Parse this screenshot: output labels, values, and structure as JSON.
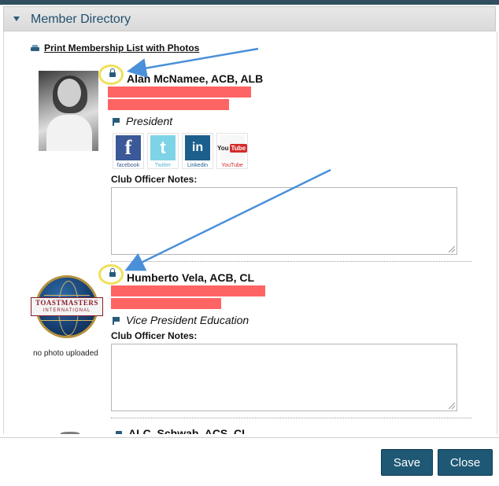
{
  "header": {
    "title": "Member Directory"
  },
  "print_link": {
    "label": "Print Membership List with Photos"
  },
  "members": [
    {
      "name": "Alan McNamee, ACB, ALB",
      "role": "President",
      "notes_label": "Club Officer Notes:",
      "notes_value": "",
      "social": [
        {
          "name": "facebook-icon",
          "glyph": "f",
          "caption": "facebook"
        },
        {
          "name": "twitter-icon",
          "glyph": "t",
          "caption": "Twitter"
        },
        {
          "name": "linkedin-icon",
          "glyph": "in",
          "caption": "Linkedin"
        },
        {
          "name": "youtube-icon",
          "glyph": "You",
          "glyph2": "Tube",
          "caption": "YouTube"
        }
      ]
    },
    {
      "name": "Humberto Vela, ACB, CL",
      "role": "Vice President Education",
      "no_photo": "no photo uploaded",
      "logo": {
        "line1": "TOASTMASTERS",
        "line2": "INTERNATIONAL"
      },
      "notes_label": "Club Officer Notes:",
      "notes_value": ""
    },
    {
      "name": "ALC, Schwab, ACS, CL"
    }
  ],
  "footer": {
    "save_label": "Save",
    "close_label": "Close"
  },
  "colors": {
    "accent": "#1e5874",
    "redaction": "#ff6464",
    "highlight": "#f0e05a",
    "arrow": "#4a90d9"
  }
}
